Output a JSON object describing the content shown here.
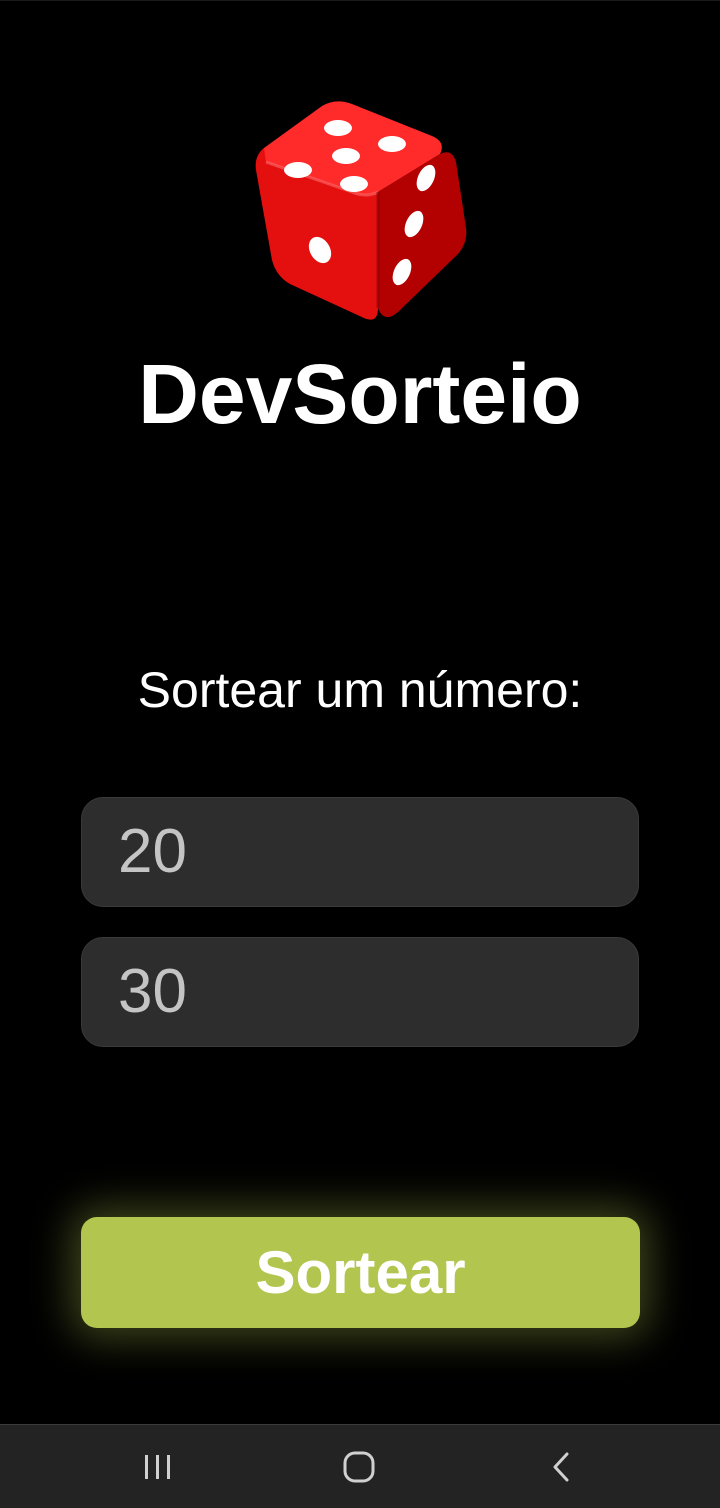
{
  "app": {
    "brand": "DevSorteio",
    "logo_icon": "red-dice-icon",
    "prompt": "Sortear um número:"
  },
  "form": {
    "min_value": "20",
    "max_value": "30",
    "submit_label": "Sortear"
  },
  "navbar": {
    "recent_icon": "recent-apps-icon",
    "home_icon": "home-icon",
    "back_icon": "back-icon"
  },
  "colors": {
    "background": "#000000",
    "field_background": "#2d2d2d",
    "field_text": "#c4c4c4",
    "button": "#b2c54e",
    "dice": "#e01010",
    "navbar": "#232323"
  }
}
